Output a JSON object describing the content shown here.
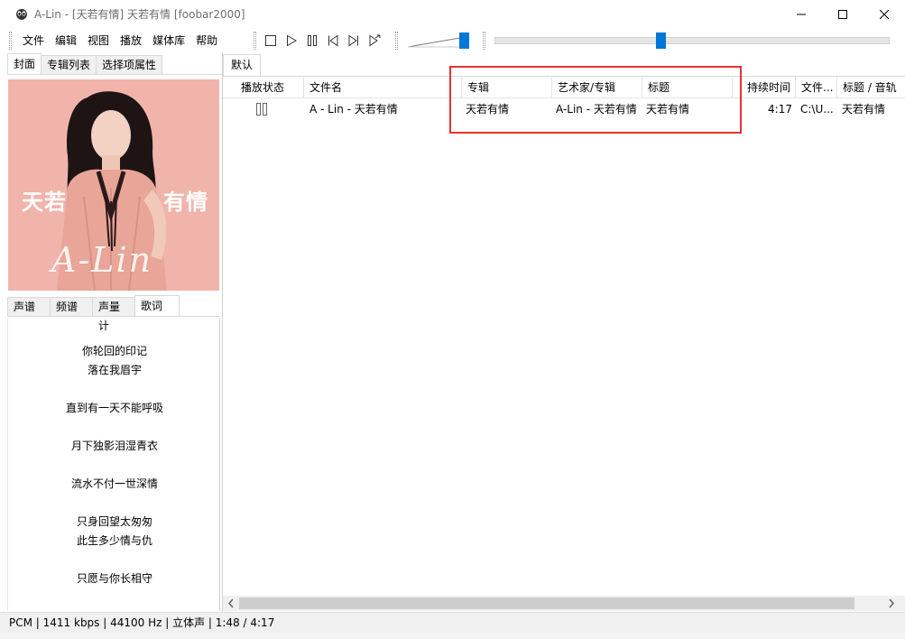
{
  "window": {
    "title": "A-Lin - [天若有情] 天若有情  [foobar2000]"
  },
  "menu": [
    "文件",
    "编辑",
    "视图",
    "播放",
    "媒体库",
    "帮助"
  ],
  "left_panel": {
    "top_tabs": [
      "封面",
      "专辑列表",
      "选择项属性"
    ],
    "active_top_tab": "封面",
    "cover": {
      "title_left": "天若",
      "title_right": "有情",
      "signature": "A-Lin",
      "bg_color": "#f0b4ab"
    },
    "bottom_tabs": [
      "声谱",
      "频谱",
      "声量计",
      "歌词"
    ],
    "active_bottom_tab": "歌词",
    "lyrics": [
      "你轮回的印记",
      "落在我眉宇",
      "直到有一天不能呼吸",
      "月下独影泪湿青衣",
      "流水不付一世深情",
      "只身回望太匆匆",
      "此生多少情与仇",
      "只愿与你长相守"
    ]
  },
  "playlist": {
    "tab": "默认",
    "columns": {
      "play_status": "播放状态",
      "filename": "文件名",
      "album": "专辑",
      "artist_album": "艺术家/专辑",
      "title": "标题",
      "duration": "持续时间",
      "file_path": "文件...",
      "title_track": "标题 / 音轨"
    },
    "rows": [
      {
        "filename": "A - Lin - 天若有情",
        "album": "天若有情",
        "artist_album": "A-Lin - 天若有情",
        "title": "天若有情",
        "duration": "4:17",
        "file_path": "C:\\U...",
        "title_track": "天若有情"
      }
    ]
  },
  "status_bar": "PCM | 1411 kbps | 44100 Hz | 立体声 | 1:48 / 4:17",
  "colors": {
    "accent": "#0078d7",
    "highlight_box": "#e53333"
  },
  "playback_progress": {
    "position": "1:48",
    "length": "4:17"
  }
}
